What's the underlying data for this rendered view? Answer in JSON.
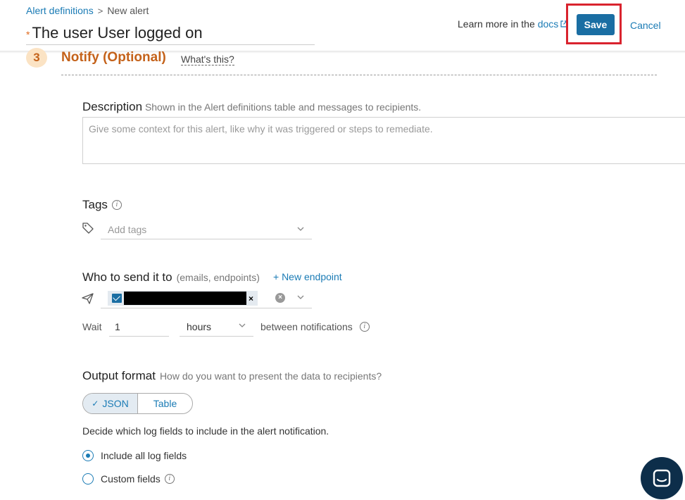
{
  "breadcrumb": {
    "parent": "Alert definitions",
    "separator": ">",
    "current": "New alert"
  },
  "alert": {
    "required_mark": "*",
    "title": "The user User logged on"
  },
  "header": {
    "learn_more": "Learn more in the",
    "docs_link": "docs",
    "save_label": "Save",
    "cancel_label": "Cancel"
  },
  "step": {
    "number": "3",
    "title": "Notify (Optional)",
    "help_link": "What's this?"
  },
  "description": {
    "label": "Description",
    "hint": "Shown in the Alert definitions table and messages to recipients.",
    "placeholder": "Give some context for this alert, like why it was triggered or steps to remediate."
  },
  "tags": {
    "label": "Tags",
    "placeholder": "Add tags"
  },
  "send": {
    "label": "Who to send it to",
    "hint": "(emails, endpoints)",
    "new_endpoint": "+ New endpoint",
    "chip_remove": "×",
    "clear_symbol": "×"
  },
  "wait": {
    "label": "Wait",
    "value": "1",
    "unit": "hours",
    "suffix": "between notifications"
  },
  "output": {
    "label": "Output format",
    "hint": "How do you want to present the data to recipients?",
    "options": [
      "JSON",
      "Table"
    ],
    "selected": "JSON",
    "check": "✓",
    "decide_text": "Decide which log fields to include in the alert notification.",
    "radio_all": "Include all log fields",
    "radio_custom": "Custom fields",
    "radio_selected": "Include all log fields"
  },
  "colors": {
    "accent": "#1a7bb5",
    "save_button": "#1a6ea3",
    "step": "#c4621a",
    "highlight": "#d9232e",
    "chat": "#0d2e4a"
  },
  "icons": [
    "chevron-right-icon",
    "external-link-icon",
    "info-icon",
    "tag-icon",
    "chevron-down-icon",
    "paper-plane-icon",
    "mail-icon",
    "clear-icon",
    "check-icon",
    "chat-icon"
  ]
}
